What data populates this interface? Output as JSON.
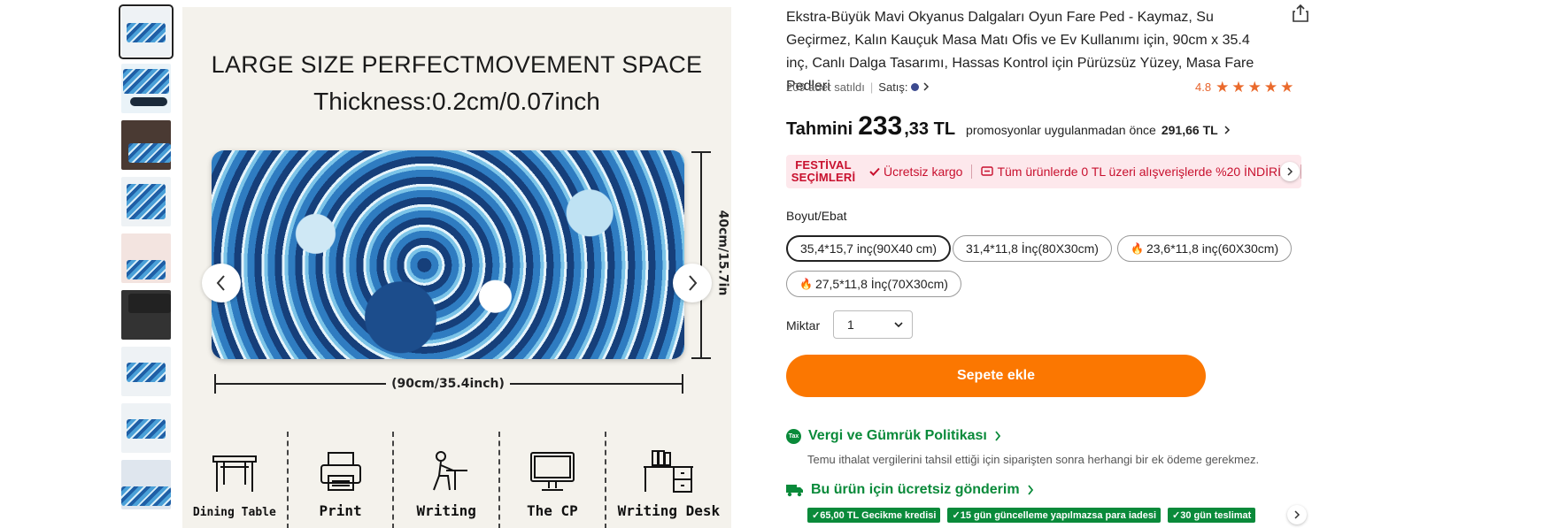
{
  "main_image": {
    "heading": "LARGE SIZE PERFECTMOVEMENT SPACE",
    "thickness": "Thickness:0.2cm/0.07inch",
    "width_label": "(90cm/35.4inch)",
    "height_label": "40cm/15.7in",
    "uses": [
      {
        "label": "Dining Table",
        "icon": "dining-table-icon"
      },
      {
        "label": "Print",
        "icon": "printer-icon"
      },
      {
        "label": "Writing",
        "icon": "writing-person-icon"
      },
      {
        "label": "The CP",
        "icon": "computer-monitor-icon"
      },
      {
        "label": "Writing Desk",
        "icon": "writing-desk-icon"
      }
    ]
  },
  "product": {
    "title": "Ekstra-Büyük Mavi Okyanus Dalgaları Oyun Fare Ped - Kaymaz, Su Geçirmez, Kalın Kauçuk Masa Matı Ofis ve Ev Kullanımı için, 90cm x 35.4 inç, Canlı Dalga Tasarımı, Hassas Kontrol için Pürüzsüz Yüzey, Masa Fare Pedleri",
    "sold": "209 adet satıldı",
    "seller_label": "Satış:",
    "rating": "4.8",
    "stars": 5
  },
  "price": {
    "estimated_label": "Tahmini",
    "whole": "233",
    "decimal": ",33 TL",
    "note": "promosyonlar uygulanmadan önce",
    "original": "291,66 TL"
  },
  "promo": {
    "festival": "FESTİVAL SEÇİMLERİ",
    "free_shipping": "Ücretsiz kargo",
    "discount": "Tüm ürünlerde 0 TL üzeri alışverişlerde %20 İNDİRİM"
  },
  "size": {
    "label": "Boyut/Ebat",
    "options": [
      "35,4*15,7 inç(90X40 cm)",
      "31,4*11,8 İnç(80X30cm)",
      "23,6*11,8 inç(60X30cm)",
      "27,5*11,8 İnç(70X30cm)"
    ]
  },
  "quantity": {
    "label": "Miktar",
    "value": "1"
  },
  "cart_button": "Sepete ekle",
  "tax": {
    "badge": "Tax",
    "link": "Vergi ve Gümrük Politikası",
    "description": "Temu ithalat vergilerini tahsil ettiği için siparişten sonra herhangi bir ek ödeme gerekmez."
  },
  "shipping": {
    "link": "Bu ürün için ücretsiz gönderim",
    "badges": [
      "✓65,00 TL Gecikme kredisi",
      "✓15 gün güncelleme yapılmazsa para iadesi",
      "✓30 gün teslimat"
    ]
  },
  "colors": {
    "accent": "#fb7701",
    "green": "#0a8a3a",
    "promo_red": "#c8102e",
    "star": "#ea6a2c"
  }
}
